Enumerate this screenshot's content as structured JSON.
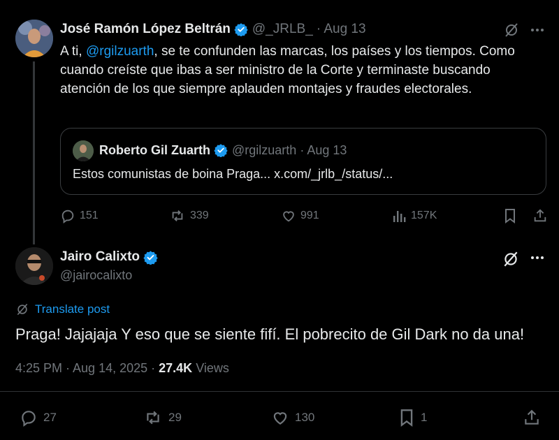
{
  "tweet1": {
    "name": "José Ramón López Beltrán",
    "handle": "@_JRLB_",
    "date": "· Aug 13",
    "text_prefix": "A ti, ",
    "mention": "@rgilzuarth",
    "text_suffix": ", se te confunden las marcas, los países y los tiempos. Como cuando creíste que ibas a ser ministro de la Corte y terminaste buscando atención de los que siempre aplauden montajes y fraudes electorales.",
    "quote": {
      "name": "Roberto Gil Zuarth",
      "handle": "@rgilzuarth",
      "date": "· Aug 13",
      "text": "Estos comunistas de boina Praga... x.com/_jrlb_/status/..."
    },
    "actions": {
      "replies": "151",
      "reposts": "339",
      "likes": "991",
      "views": "157K"
    }
  },
  "tweet2": {
    "name": "Jairo Calixto",
    "handle": "@jairocalixto",
    "translate_label": "Translate post",
    "text": "Praga! Jajajaja Y eso que se siente fifí. El pobrecito de Gil Dark no da una!",
    "timestamp": "4:25 PM · Aug 14, 2025 ·",
    "views_count": "27.4K",
    "views_label": "Views",
    "actions": {
      "replies": "27",
      "reposts": "29",
      "likes": "130",
      "bookmarks": "1"
    }
  },
  "colors": {
    "background": "#000000",
    "text": "#e7e9ea",
    "muted": "#71767b",
    "accent": "#1d9bf0"
  },
  "icons": [
    "verified-badge-icon",
    "grok-icon",
    "more-icon",
    "reply-icon",
    "repost-icon",
    "like-icon",
    "views-icon",
    "bookmark-icon",
    "share-icon",
    "translate-icon"
  ]
}
